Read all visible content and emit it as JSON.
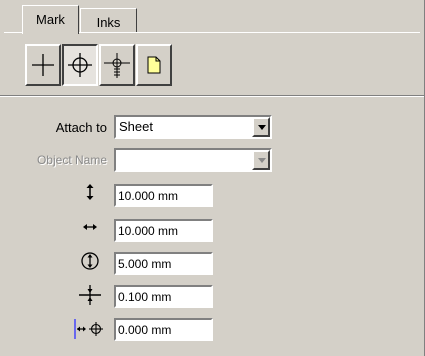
{
  "tabs": [
    {
      "label": "Mark",
      "active": true
    },
    {
      "label": "Inks",
      "active": false
    }
  ],
  "toolbar": {
    "buttons": [
      {
        "icon": "crosshair-plain-icon",
        "pressed": false
      },
      {
        "icon": "crosshair-circle-icon",
        "pressed": true
      },
      {
        "icon": "crosshair-tick-icon",
        "pressed": false
      },
      {
        "icon": "page-icon",
        "pressed": false
      }
    ]
  },
  "attach_to": {
    "label": "Attach to",
    "value": "Sheet"
  },
  "object_name": {
    "label": "Object Name",
    "value": "",
    "disabled": true
  },
  "fields": [
    {
      "icon": "vertical-arrows-icon",
      "value": "10.000 mm"
    },
    {
      "icon": "horizontal-arrows-icon",
      "value": "10.000 mm"
    },
    {
      "icon": "circle-diameter-icon",
      "value": "5.000 mm"
    },
    {
      "icon": "line-weight-icon",
      "value": "0.100 mm"
    },
    {
      "icon": "offset-icon",
      "value": "0.000 mm"
    }
  ]
}
